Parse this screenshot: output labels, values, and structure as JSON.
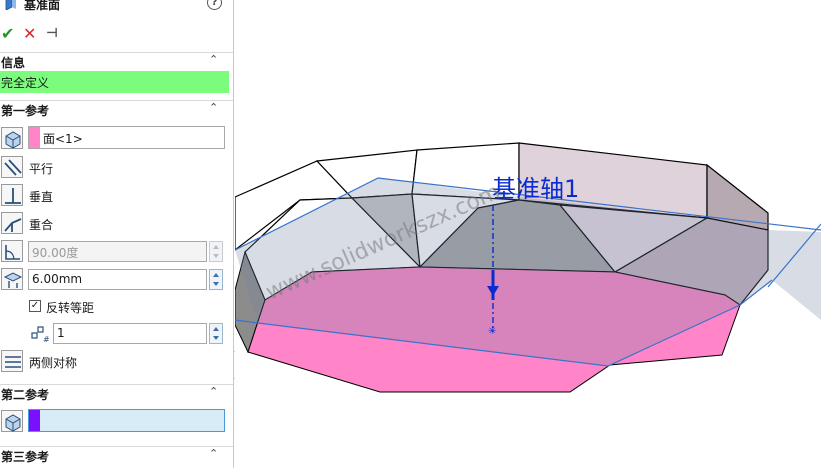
{
  "panel": {
    "title": "基准面",
    "help": "?",
    "ok": "✔",
    "cancel": "✕",
    "pin": "⊣",
    "info": {
      "header": "信息",
      "status": "完全定义"
    },
    "first_ref": {
      "header": "第一参考",
      "selection": "面<1>",
      "swatch_color": "#ff85c8",
      "options": [
        {
          "label": "平行",
          "icon": "parallel-icon"
        },
        {
          "label": "垂直",
          "icon": "perpendicular-icon"
        },
        {
          "label": "重合",
          "icon": "coincident-icon"
        }
      ],
      "angle": "90.00度",
      "distance": "6.00mm",
      "flip_offset": "反转等距",
      "flip_checked": true,
      "instances": "1",
      "mid_plane": "两侧对称"
    },
    "second_ref": {
      "header": "第二参考",
      "swatch_color": "#7a10ff"
    },
    "third_ref": {
      "header": "第三参考"
    }
  },
  "viewport": {
    "axis_label": "基准轴1",
    "watermark": "www.solidworkszx.com",
    "colors": {
      "face_highlight": "#ff85c8",
      "plane_fill": "#6e82a0",
      "plane_edge": "#3a73c8",
      "axis": "#0a2bd0"
    }
  }
}
